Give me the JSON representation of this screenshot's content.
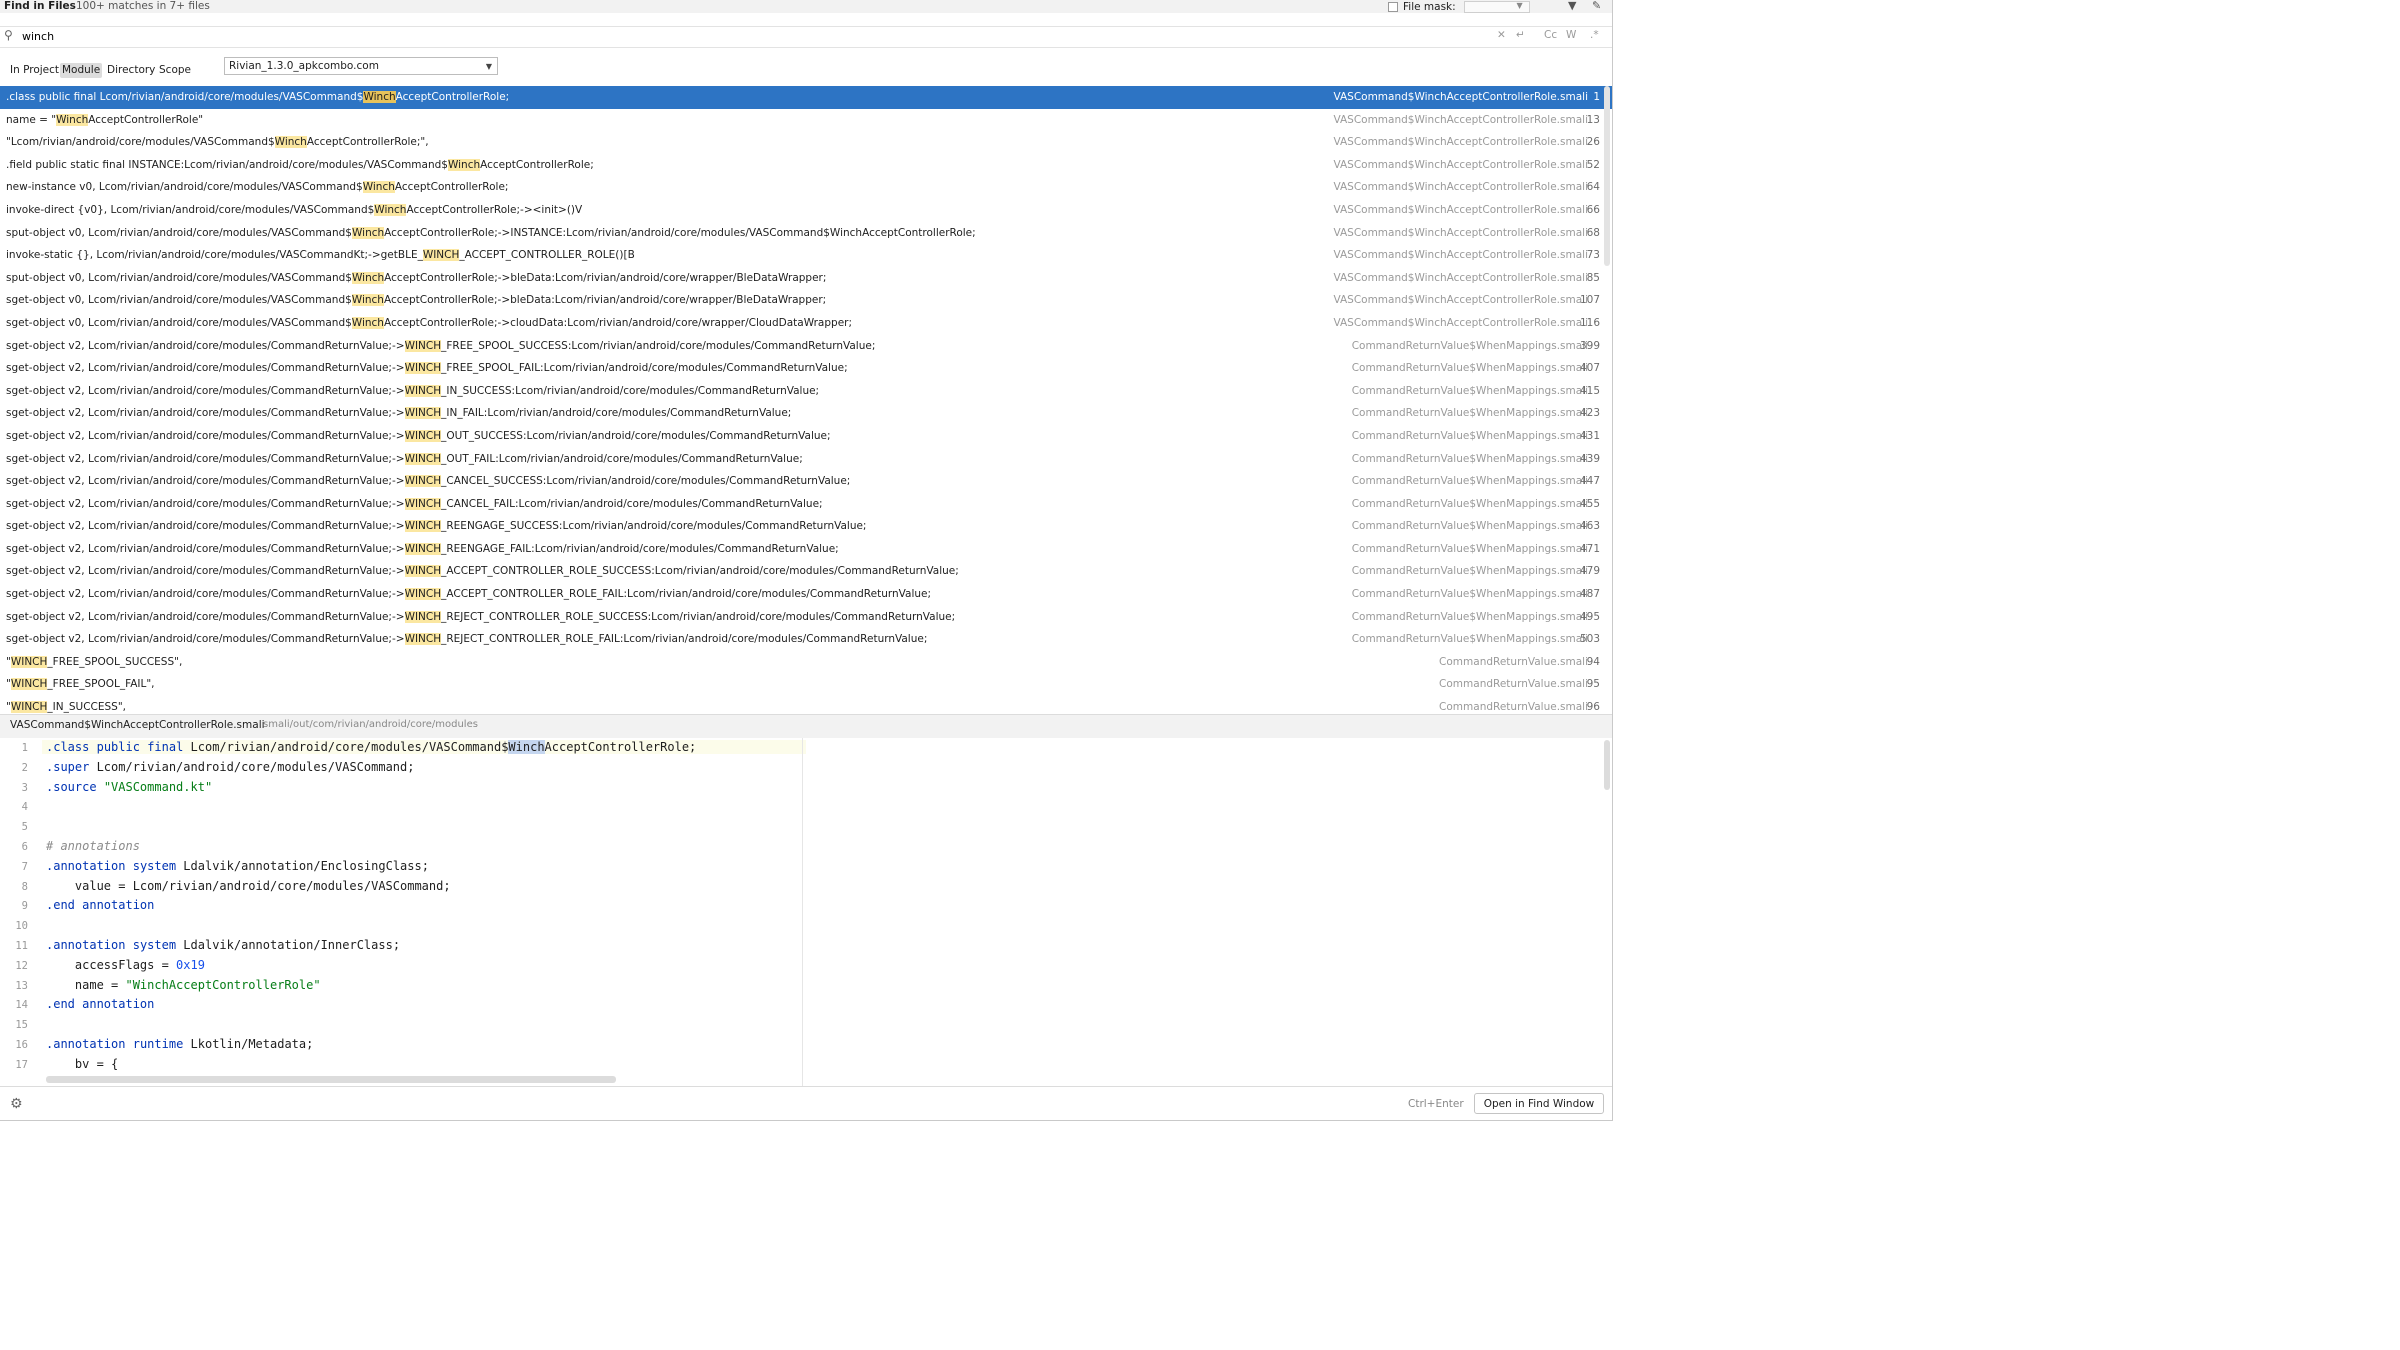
{
  "titlebar": {
    "title": "Find in Files",
    "summary": "100+ matches in 7+ files",
    "file_mask_label": "File mask:"
  },
  "search": {
    "query": "winch",
    "cc_label": "Cc",
    "w_label": "W"
  },
  "scope": {
    "tabs": [
      "In Project",
      "Module",
      "Directory",
      "Scope"
    ],
    "selected_tab": "Module",
    "module_value": "Rivian_1.3.0_apkcombo.com"
  },
  "results": [
    {
      "pre": ".class public final Lcom/rivian/android/core/modules/VASCommand$",
      "hl": "Winch",
      "post": "AcceptControllerRole;",
      "file": "VASCommand$WinchAcceptControllerRole.smali",
      "line": "1",
      "selected": true
    },
    {
      "pre": "name = \"",
      "hl": "Winch",
      "post": "AcceptControllerRole\"",
      "file": "VASCommand$WinchAcceptControllerRole.smali",
      "line": "13"
    },
    {
      "pre": "\"Lcom/rivian/android/core/modules/VASCommand$",
      "hl": "Winch",
      "post": "AcceptControllerRole;\",",
      "file": "VASCommand$WinchAcceptControllerRole.smali",
      "line": "26"
    },
    {
      "pre": ".field public static final INSTANCE:Lcom/rivian/android/core/modules/VASCommand$",
      "hl": "Winch",
      "post": "AcceptControllerRole;",
      "file": "VASCommand$WinchAcceptControllerRole.smali",
      "line": "52"
    },
    {
      "pre": "new-instance v0, Lcom/rivian/android/core/modules/VASCommand$",
      "hl": "Winch",
      "post": "AcceptControllerRole;",
      "file": "VASCommand$WinchAcceptControllerRole.smali",
      "line": "64"
    },
    {
      "pre": "invoke-direct {v0}, Lcom/rivian/android/core/modules/VASCommand$",
      "hl": "Winch",
      "post": "AcceptControllerRole;-><init>()V",
      "file": "VASCommand$WinchAcceptControllerRole.smali",
      "line": "66"
    },
    {
      "pre": "sput-object v0, Lcom/rivian/android/core/modules/VASCommand$",
      "hl": "Winch",
      "post": "AcceptControllerRole;->INSTANCE:Lcom/rivian/android/core/modules/VASCommand$WinchAcceptControllerRole;",
      "file": "VASCommand$WinchAcceptControllerRole.smali",
      "line": "68"
    },
    {
      "pre": "invoke-static {}, Lcom/rivian/android/core/modules/VASCommandKt;->getBLE_",
      "hl": "WINCH",
      "post": "_ACCEPT_CONTROLLER_ROLE()[B",
      "file": "VASCommand$WinchAcceptControllerRole.smali",
      "line": "73"
    },
    {
      "pre": "sput-object v0, Lcom/rivian/android/core/modules/VASCommand$",
      "hl": "Winch",
      "post": "AcceptControllerRole;->bleData:Lcom/rivian/android/core/wrapper/BleDataWrapper;",
      "file": "VASCommand$WinchAcceptControllerRole.smali",
      "line": "85"
    },
    {
      "pre": "sget-object v0, Lcom/rivian/android/core/modules/VASCommand$",
      "hl": "Winch",
      "post": "AcceptControllerRole;->bleData:Lcom/rivian/android/core/wrapper/BleDataWrapper;",
      "file": "VASCommand$WinchAcceptControllerRole.smali",
      "line": "107"
    },
    {
      "pre": "sget-object v0, Lcom/rivian/android/core/modules/VASCommand$",
      "hl": "Winch",
      "post": "AcceptControllerRole;->cloudData:Lcom/rivian/android/core/wrapper/CloudDataWrapper;",
      "file": "VASCommand$WinchAcceptControllerRole.smali",
      "line": "116"
    },
    {
      "pre": "sget-object v2, Lcom/rivian/android/core/modules/CommandReturnValue;->",
      "hl": "WINCH",
      "post": "_FREE_SPOOL_SUCCESS:Lcom/rivian/android/core/modules/CommandReturnValue;",
      "file": "CommandReturnValue$WhenMappings.smali",
      "line": "399"
    },
    {
      "pre": "sget-object v2, Lcom/rivian/android/core/modules/CommandReturnValue;->",
      "hl": "WINCH",
      "post": "_FREE_SPOOL_FAIL:Lcom/rivian/android/core/modules/CommandReturnValue;",
      "file": "CommandReturnValue$WhenMappings.smali",
      "line": "407"
    },
    {
      "pre": "sget-object v2, Lcom/rivian/android/core/modules/CommandReturnValue;->",
      "hl": "WINCH",
      "post": "_IN_SUCCESS:Lcom/rivian/android/core/modules/CommandReturnValue;",
      "file": "CommandReturnValue$WhenMappings.smali",
      "line": "415"
    },
    {
      "pre": "sget-object v2, Lcom/rivian/android/core/modules/CommandReturnValue;->",
      "hl": "WINCH",
      "post": "_IN_FAIL:Lcom/rivian/android/core/modules/CommandReturnValue;",
      "file": "CommandReturnValue$WhenMappings.smali",
      "line": "423"
    },
    {
      "pre": "sget-object v2, Lcom/rivian/android/core/modules/CommandReturnValue;->",
      "hl": "WINCH",
      "post": "_OUT_SUCCESS:Lcom/rivian/android/core/modules/CommandReturnValue;",
      "file": "CommandReturnValue$WhenMappings.smali",
      "line": "431"
    },
    {
      "pre": "sget-object v2, Lcom/rivian/android/core/modules/CommandReturnValue;->",
      "hl": "WINCH",
      "post": "_OUT_FAIL:Lcom/rivian/android/core/modules/CommandReturnValue;",
      "file": "CommandReturnValue$WhenMappings.smali",
      "line": "439"
    },
    {
      "pre": "sget-object v2, Lcom/rivian/android/core/modules/CommandReturnValue;->",
      "hl": "WINCH",
      "post": "_CANCEL_SUCCESS:Lcom/rivian/android/core/modules/CommandReturnValue;",
      "file": "CommandReturnValue$WhenMappings.smali",
      "line": "447"
    },
    {
      "pre": "sget-object v2, Lcom/rivian/android/core/modules/CommandReturnValue;->",
      "hl": "WINCH",
      "post": "_CANCEL_FAIL:Lcom/rivian/android/core/modules/CommandReturnValue;",
      "file": "CommandReturnValue$WhenMappings.smali",
      "line": "455"
    },
    {
      "pre": "sget-object v2, Lcom/rivian/android/core/modules/CommandReturnValue;->",
      "hl": "WINCH",
      "post": "_REENGAGE_SUCCESS:Lcom/rivian/android/core/modules/CommandReturnValue;",
      "file": "CommandReturnValue$WhenMappings.smali",
      "line": "463"
    },
    {
      "pre": "sget-object v2, Lcom/rivian/android/core/modules/CommandReturnValue;->",
      "hl": "WINCH",
      "post": "_REENGAGE_FAIL:Lcom/rivian/android/core/modules/CommandReturnValue;",
      "file": "CommandReturnValue$WhenMappings.smali",
      "line": "471"
    },
    {
      "pre": "sget-object v2, Lcom/rivian/android/core/modules/CommandReturnValue;->",
      "hl": "WINCH",
      "post": "_ACCEPT_CONTROLLER_ROLE_SUCCESS:Lcom/rivian/android/core/modules/CommandReturnValue;",
      "file": "CommandReturnValue$WhenMappings.smali",
      "line": "479"
    },
    {
      "pre": "sget-object v2, Lcom/rivian/android/core/modules/CommandReturnValue;->",
      "hl": "WINCH",
      "post": "_ACCEPT_CONTROLLER_ROLE_FAIL:Lcom/rivian/android/core/modules/CommandReturnValue;",
      "file": "CommandReturnValue$WhenMappings.smali",
      "line": "487"
    },
    {
      "pre": "sget-object v2, Lcom/rivian/android/core/modules/CommandReturnValue;->",
      "hl": "WINCH",
      "post": "_REJECT_CONTROLLER_ROLE_SUCCESS:Lcom/rivian/android/core/modules/CommandReturnValue;",
      "file": "CommandReturnValue$WhenMappings.smali",
      "line": "495"
    },
    {
      "pre": "sget-object v2, Lcom/rivian/android/core/modules/CommandReturnValue;->",
      "hl": "WINCH",
      "post": "_REJECT_CONTROLLER_ROLE_FAIL:Lcom/rivian/android/core/modules/CommandReturnValue;",
      "file": "CommandReturnValue$WhenMappings.smali",
      "line": "503"
    },
    {
      "pre": "\"",
      "hl": "WINCH",
      "post": "_FREE_SPOOL_SUCCESS\",",
      "file": "CommandReturnValue.smali",
      "line": "94"
    },
    {
      "pre": "\"",
      "hl": "WINCH",
      "post": "_FREE_SPOOL_FAIL\",",
      "file": "CommandReturnValue.smali",
      "line": "95"
    },
    {
      "pre": "\"",
      "hl": "WINCH",
      "post": "_IN_SUCCESS\",",
      "file": "CommandReturnValue.smali",
      "line": "96"
    }
  ],
  "preview": {
    "file_name": "VASCommand$WinchAcceptControllerRole.smali",
    "file_path": "smali/out/com/rivian/android/core/modules",
    "lines": [
      {
        "n": "1",
        "t": ".class public final Lcom/rivian/android/core/modules/VASCommand$WinchAcceptControllerRole;"
      },
      {
        "n": "2",
        "t": ".super Lcom/rivian/android/core/modules/VASCommand;"
      },
      {
        "n": "3",
        "t": ".source \"VASCommand.kt\""
      },
      {
        "n": "4",
        "t": ""
      },
      {
        "n": "5",
        "t": ""
      },
      {
        "n": "6",
        "t": "# annotations"
      },
      {
        "n": "7",
        "t": ".annotation system Ldalvik/annotation/EnclosingClass;"
      },
      {
        "n": "8",
        "t": "    value = Lcom/rivian/android/core/modules/VASCommand;"
      },
      {
        "n": "9",
        "t": ".end annotation"
      },
      {
        "n": "10",
        "t": ""
      },
      {
        "n": "11",
        "t": ".annotation system Ldalvik/annotation/InnerClass;"
      },
      {
        "n": "12",
        "t": "    accessFlags = 0x19"
      },
      {
        "n": "13",
        "t": "    name = \"WinchAcceptControllerRole\""
      },
      {
        "n": "14",
        "t": ".end annotation"
      },
      {
        "n": "15",
        "t": ""
      },
      {
        "n": "16",
        "t": ".annotation runtime Lkotlin/Metadata;"
      },
      {
        "n": "17",
        "t": "    bv = {"
      }
    ]
  },
  "bottom": {
    "shortcut": "Ctrl+Enter",
    "open_button": "Open in Find Window"
  },
  "colors": {
    "selection": "#2d74c4",
    "match_highlight": "#fbe7a1",
    "keyword": "#0033b3",
    "string": "#067d17"
  }
}
